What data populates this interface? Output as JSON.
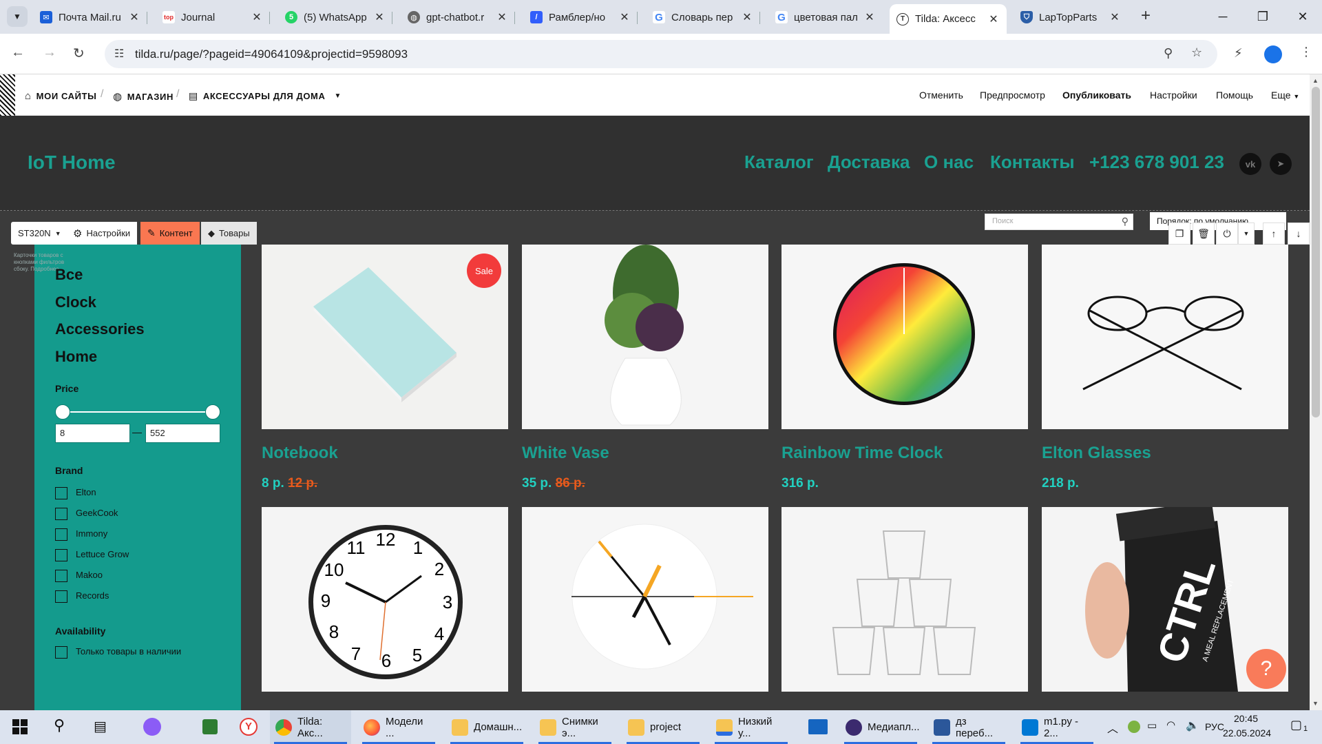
{
  "browser": {
    "tabs": [
      {
        "title": "Почта Mail.ru",
        "icon": "mail-icon",
        "color": "#1a5fd8"
      },
      {
        "title": "Journal",
        "icon": "top-icon",
        "color": "#e02828"
      },
      {
        "title": "(5) WhatsApp",
        "icon": "whatsapp-icon",
        "color": "#25d366"
      },
      {
        "title": "gpt-chatbot.r",
        "icon": "globe-icon",
        "color": "#555555"
      },
      {
        "title": "Рамблер/но",
        "icon": "rambler-icon",
        "color": "#315efb"
      },
      {
        "title": "Словарь пер",
        "icon": "google-icon",
        "color": "#4285f4"
      },
      {
        "title": "цветовая пал",
        "icon": "google-icon",
        "color": "#4285f4"
      },
      {
        "title": "Tilda: Аксесс",
        "icon": "tilda-icon",
        "color": "#333333"
      },
      {
        "title": "LapTopParts",
        "icon": "shield-icon",
        "color": "#2b5ea7"
      }
    ],
    "url": "tilda.ru/page/?pageid=49064109&projectid=9598093"
  },
  "editor": {
    "crumbs": [
      "МОИ САЙТЫ",
      "МАГАЗИН",
      "АКСЕССУАРЫ ДЛЯ ДОМА"
    ],
    "menu": [
      "Отменить",
      "Предпросмотр",
      "Опубликовать",
      "Настройки",
      "Помощь",
      "Еще"
    ],
    "block_id": "ST320N",
    "tools": {
      "settings": "Настройки",
      "content": "Контент",
      "products": "Товары"
    },
    "search_placeholder": "Поиск",
    "sort_label": "Порядок: по умолчанию",
    "hint": "Карточки товаров с кнопками фильтров сбоку. Подробнее"
  },
  "site": {
    "logo": "IoT Home",
    "nav": [
      "Каталог",
      "Доставка",
      "О нас",
      "Контакты",
      "+123 678 901 23"
    ],
    "social": [
      "vk",
      "tg"
    ]
  },
  "sidebar": {
    "categories": [
      "Все",
      "Clock",
      "Accessories",
      "Home"
    ],
    "price_label": "Price",
    "price_min": "8",
    "price_max": "552",
    "brand_label": "Brand",
    "brands": [
      "Elton",
      "GeekCook",
      "Immony",
      "Lettuce Grow",
      "Makoo",
      "Records"
    ],
    "availability_label": "Availability",
    "availability_option": "Только товары в наличии"
  },
  "products": [
    {
      "title": "Notebook",
      "price": "8 р.",
      "old_price": "12 р.",
      "badge": "Sale"
    },
    {
      "title": "White Vase",
      "price": "35 р.",
      "old_price": "86 р."
    },
    {
      "title": "Rainbow Time Clock",
      "price": "316 р."
    },
    {
      "title": "Elton Glasses",
      "price": "218 р."
    }
  ],
  "clock_numbers": [
    "12",
    "1",
    "2",
    "3",
    "4",
    "5",
    "6",
    "7",
    "8",
    "9",
    "10",
    "11"
  ],
  "bottle_text": "CTRL",
  "bottle_subtext": "A MEAL REPLACEMENT",
  "taskbar": {
    "apps": [
      "Tilda: Акс...",
      "Модели ...",
      "Домашн...",
      "Снимки э...",
      "project",
      "Низкий у...",
      "Медиапл...",
      "дз переб...",
      "m1.py - 2..."
    ],
    "lang": "РУС",
    "time": "20:45",
    "date": "22.05.2024",
    "notifications": "1"
  }
}
